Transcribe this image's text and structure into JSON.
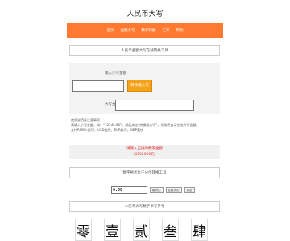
{
  "site": {
    "title": "人民币大写"
  },
  "nav": {
    "items": [
      "首页",
      "金额大写",
      "数字转换",
      "汇率",
      "帮助"
    ]
  },
  "converter": {
    "header": "人民币金额大写在线转换工具",
    "input_label": "输入小写金额",
    "input_value": "",
    "convert_label": "转换成大写",
    "result_label": "大写金额",
    "result_value": ""
  },
  "notes": {
    "title": "使用说明及注意事项",
    "line1": "请输入小写金额，如：“12345.56”，然后点击“转换成大写”，系统将自动生成大写金额。",
    "line2": "支持RMB人民币、USD美元、EUR欧元、GBP英镑"
  },
  "error": {
    "line1": "请输入正确的数字金额",
    "line2": "（4302000元）"
  },
  "format_section": {
    "header": "数字格式化千分位转换工具"
  },
  "format_tool": {
    "value": "0.00",
    "buttons": [
      "格式化",
      "反格式化",
      "清空"
    ]
  },
  "numerals_section": {
    "header": "人民币大写数字书写参考"
  },
  "numerals": [
    "零",
    "壹",
    "贰",
    "叁",
    "肆"
  ],
  "colors": {
    "nav": "#ff7a30",
    "button": "#f3a21a",
    "error": "#e03030"
  }
}
